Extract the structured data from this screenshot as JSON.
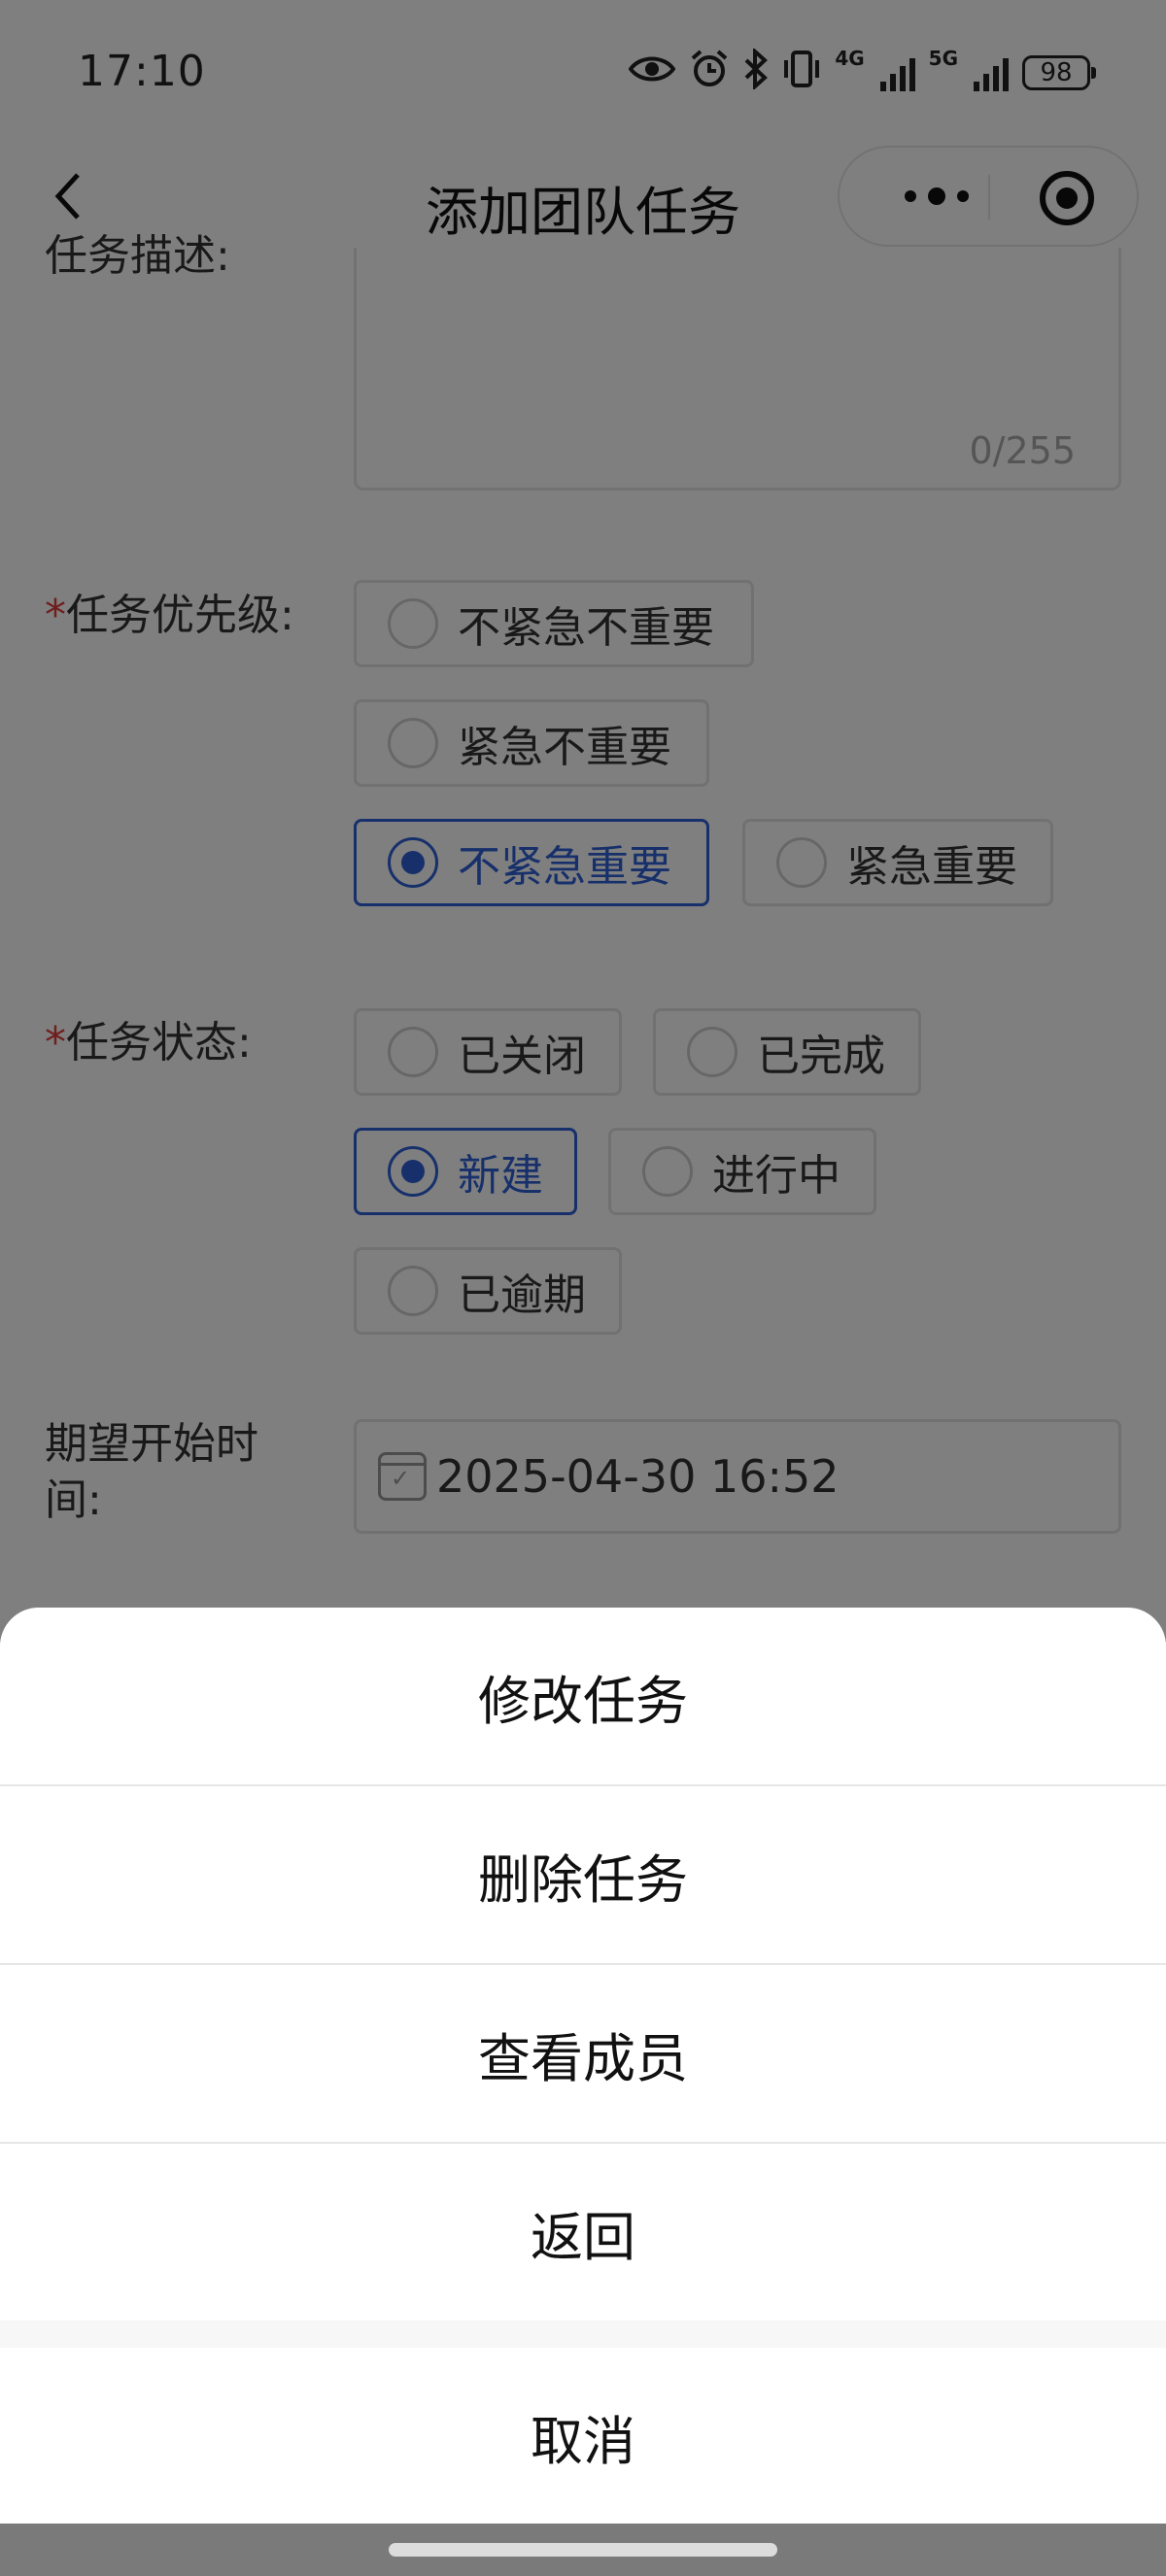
{
  "status_bar": {
    "time": "17:10",
    "network1": "4G",
    "network2": "5G",
    "battery": "98",
    "icons": [
      "eye-icon",
      "alarm-icon",
      "bluetooth-icon",
      "vibrate-icon",
      "signal-icon",
      "signal-icon",
      "battery-icon"
    ]
  },
  "navbar": {
    "title": "添加团队任务",
    "back_icon": "chevron-left-icon",
    "more_icon": "more-dots-icon",
    "close_icon": "target-icon"
  },
  "form": {
    "description_label": "任务描述:",
    "description_counter": "0/255",
    "priority": {
      "label": "任务优先级:",
      "options": [
        "不紧急不重要",
        "紧急不重要",
        "不紧急重要",
        "紧急重要"
      ],
      "selected": "不紧急重要"
    },
    "status": {
      "label": "任务状态:",
      "options": [
        "已关闭",
        "已完成",
        "新建",
        "进行中",
        "已逾期"
      ],
      "selected": "新建"
    },
    "start_time": {
      "label_line1": "期望开始时",
      "label_line2": "间:",
      "value": "2025-04-30 16:52",
      "icon": "calendar-icon"
    }
  },
  "action_sheet": {
    "items": [
      "修改任务",
      "删除任务",
      "查看成员",
      "返回"
    ],
    "cancel": "取消"
  },
  "colors": {
    "accent": "#2f60d6",
    "required": "#e03b3b"
  }
}
